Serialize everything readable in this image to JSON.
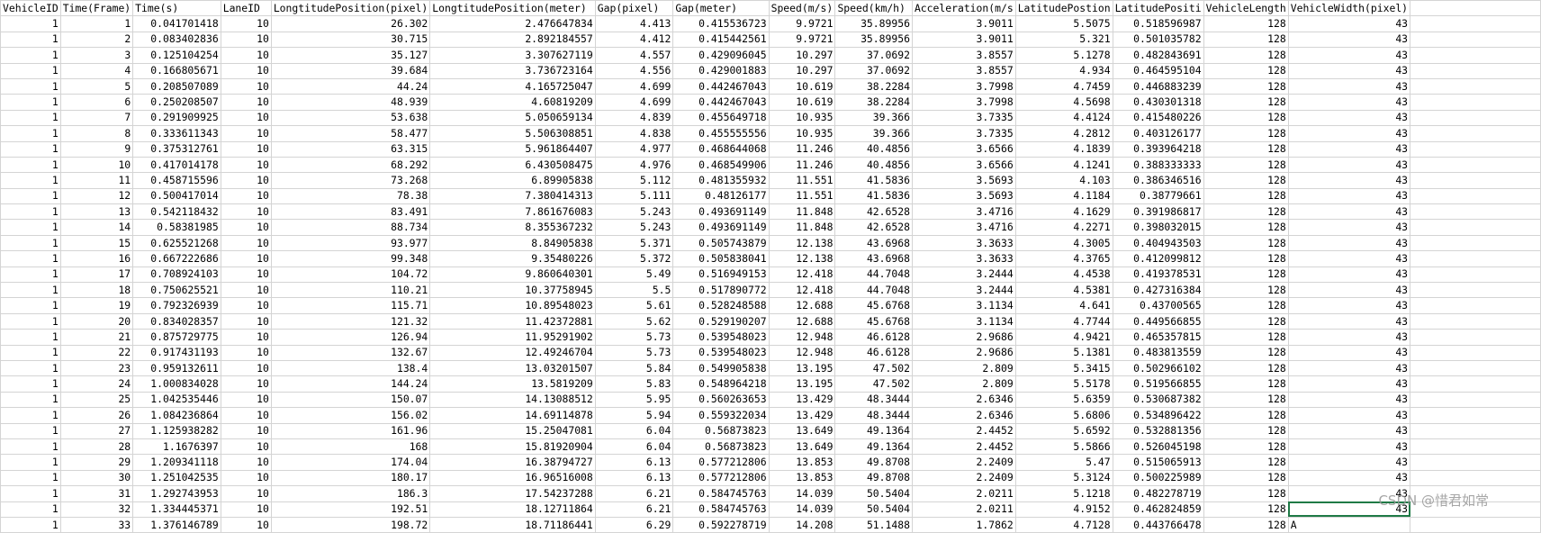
{
  "sheet": {
    "headers": [
      "VehicleID",
      "Time(Frame)",
      "Time(s)",
      "LaneID",
      "LongtitudePosition(pixel)",
      "LongtitudePosition(meter)",
      "Gap(pixel)",
      "Gap(meter)",
      "Speed(m/s)",
      "Speed(km/h)",
      "Acceleration(m/s",
      "LatitudePostion",
      "LatitudePositi",
      "VehicleLength",
      "VehicleWidth(pixel)",
      ""
    ],
    "rows": [
      [
        "1",
        "1",
        "0.041701418",
        "10",
        "26.302",
        "2.476647834",
        "4.413",
        "0.415536723",
        "9.9721",
        "35.89956",
        "3.9011",
        "5.5075",
        "0.518596987",
        "128",
        "43",
        ""
      ],
      [
        "1",
        "2",
        "0.083402836",
        "10",
        "30.715",
        "2.892184557",
        "4.412",
        "0.415442561",
        "9.9721",
        "35.89956",
        "3.9011",
        "5.321",
        "0.501035782",
        "128",
        "43",
        ""
      ],
      [
        "1",
        "3",
        "0.125104254",
        "10",
        "35.127",
        "3.307627119",
        "4.557",
        "0.429096045",
        "10.297",
        "37.0692",
        "3.8557",
        "5.1278",
        "0.482843691",
        "128",
        "43",
        ""
      ],
      [
        "1",
        "4",
        "0.166805671",
        "10",
        "39.684",
        "3.736723164",
        "4.556",
        "0.429001883",
        "10.297",
        "37.0692",
        "3.8557",
        "4.934",
        "0.464595104",
        "128",
        "43",
        ""
      ],
      [
        "1",
        "5",
        "0.208507089",
        "10",
        "44.24",
        "4.165725047",
        "4.699",
        "0.442467043",
        "10.619",
        "38.2284",
        "3.7998",
        "4.7459",
        "0.446883239",
        "128",
        "43",
        ""
      ],
      [
        "1",
        "6",
        "0.250208507",
        "10",
        "48.939",
        "4.60819209",
        "4.699",
        "0.442467043",
        "10.619",
        "38.2284",
        "3.7998",
        "4.5698",
        "0.430301318",
        "128",
        "43",
        ""
      ],
      [
        "1",
        "7",
        "0.291909925",
        "10",
        "53.638",
        "5.050659134",
        "4.839",
        "0.455649718",
        "10.935",
        "39.366",
        "3.7335",
        "4.4124",
        "0.415480226",
        "128",
        "43",
        ""
      ],
      [
        "1",
        "8",
        "0.333611343",
        "10",
        "58.477",
        "5.506308851",
        "4.838",
        "0.455555556",
        "10.935",
        "39.366",
        "3.7335",
        "4.2812",
        "0.403126177",
        "128",
        "43",
        ""
      ],
      [
        "1",
        "9",
        "0.375312761",
        "10",
        "63.315",
        "5.961864407",
        "4.977",
        "0.468644068",
        "11.246",
        "40.4856",
        "3.6566",
        "4.1839",
        "0.393964218",
        "128",
        "43",
        ""
      ],
      [
        "1",
        "10",
        "0.417014178",
        "10",
        "68.292",
        "6.430508475",
        "4.976",
        "0.468549906",
        "11.246",
        "40.4856",
        "3.6566",
        "4.1241",
        "0.388333333",
        "128",
        "43",
        ""
      ],
      [
        "1",
        "11",
        "0.458715596",
        "10",
        "73.268",
        "6.89905838",
        "5.112",
        "0.481355932",
        "11.551",
        "41.5836",
        "3.5693",
        "4.103",
        "0.386346516",
        "128",
        "43",
        ""
      ],
      [
        "1",
        "12",
        "0.500417014",
        "10",
        "78.38",
        "7.380414313",
        "5.111",
        "0.48126177",
        "11.551",
        "41.5836",
        "3.5693",
        "4.1184",
        "0.38779661",
        "128",
        "43",
        ""
      ],
      [
        "1",
        "13",
        "0.542118432",
        "10",
        "83.491",
        "7.861676083",
        "5.243",
        "0.493691149",
        "11.848",
        "42.6528",
        "3.4716",
        "4.1629",
        "0.391986817",
        "128",
        "43",
        ""
      ],
      [
        "1",
        "14",
        "0.58381985",
        "10",
        "88.734",
        "8.355367232",
        "5.243",
        "0.493691149",
        "11.848",
        "42.6528",
        "3.4716",
        "4.2271",
        "0.398032015",
        "128",
        "43",
        ""
      ],
      [
        "1",
        "15",
        "0.625521268",
        "10",
        "93.977",
        "8.84905838",
        "5.371",
        "0.505743879",
        "12.138",
        "43.6968",
        "3.3633",
        "4.3005",
        "0.404943503",
        "128",
        "43",
        ""
      ],
      [
        "1",
        "16",
        "0.667222686",
        "10",
        "99.348",
        "9.35480226",
        "5.372",
        "0.505838041",
        "12.138",
        "43.6968",
        "3.3633",
        "4.3765",
        "0.412099812",
        "128",
        "43",
        ""
      ],
      [
        "1",
        "17",
        "0.708924103",
        "10",
        "104.72",
        "9.860640301",
        "5.49",
        "0.516949153",
        "12.418",
        "44.7048",
        "3.2444",
        "4.4538",
        "0.419378531",
        "128",
        "43",
        ""
      ],
      [
        "1",
        "18",
        "0.750625521",
        "10",
        "110.21",
        "10.37758945",
        "5.5",
        "0.517890772",
        "12.418",
        "44.7048",
        "3.2444",
        "4.5381",
        "0.427316384",
        "128",
        "43",
        ""
      ],
      [
        "1",
        "19",
        "0.792326939",
        "10",
        "115.71",
        "10.89548023",
        "5.61",
        "0.528248588",
        "12.688",
        "45.6768",
        "3.1134",
        "4.641",
        "0.43700565",
        "128",
        "43",
        ""
      ],
      [
        "1",
        "20",
        "0.834028357",
        "10",
        "121.32",
        "11.42372881",
        "5.62",
        "0.529190207",
        "12.688",
        "45.6768",
        "3.1134",
        "4.7744",
        "0.449566855",
        "128",
        "43",
        ""
      ],
      [
        "1",
        "21",
        "0.875729775",
        "10",
        "126.94",
        "11.95291902",
        "5.73",
        "0.539548023",
        "12.948",
        "46.6128",
        "2.9686",
        "4.9421",
        "0.465357815",
        "128",
        "43",
        ""
      ],
      [
        "1",
        "22",
        "0.917431193",
        "10",
        "132.67",
        "12.49246704",
        "5.73",
        "0.539548023",
        "12.948",
        "46.6128",
        "2.9686",
        "5.1381",
        "0.483813559",
        "128",
        "43",
        ""
      ],
      [
        "1",
        "23",
        "0.959132611",
        "10",
        "138.4",
        "13.03201507",
        "5.84",
        "0.549905838",
        "13.195",
        "47.502",
        "2.809",
        "5.3415",
        "0.502966102",
        "128",
        "43",
        ""
      ],
      [
        "1",
        "24",
        "1.000834028",
        "10",
        "144.24",
        "13.5819209",
        "5.83",
        "0.548964218",
        "13.195",
        "47.502",
        "2.809",
        "5.5178",
        "0.519566855",
        "128",
        "43",
        ""
      ],
      [
        "1",
        "25",
        "1.042535446",
        "10",
        "150.07",
        "14.13088512",
        "5.95",
        "0.560263653",
        "13.429",
        "48.3444",
        "2.6346",
        "5.6359",
        "0.530687382",
        "128",
        "43",
        ""
      ],
      [
        "1",
        "26",
        "1.084236864",
        "10",
        "156.02",
        "14.69114878",
        "5.94",
        "0.559322034",
        "13.429",
        "48.3444",
        "2.6346",
        "5.6806",
        "0.534896422",
        "128",
        "43",
        ""
      ],
      [
        "1",
        "27",
        "1.125938282",
        "10",
        "161.96",
        "15.25047081",
        "6.04",
        "0.56873823",
        "13.649",
        "49.1364",
        "2.4452",
        "5.6592",
        "0.532881356",
        "128",
        "43",
        ""
      ],
      [
        "1",
        "28",
        "1.1676397",
        "10",
        "168",
        "15.81920904",
        "6.04",
        "0.56873823",
        "13.649",
        "49.1364",
        "2.4452",
        "5.5866",
        "0.526045198",
        "128",
        "43",
        ""
      ],
      [
        "1",
        "29",
        "1.209341118",
        "10",
        "174.04",
        "16.38794727",
        "6.13",
        "0.577212806",
        "13.853",
        "49.8708",
        "2.2409",
        "5.47",
        "0.515065913",
        "128",
        "43",
        ""
      ],
      [
        "1",
        "30",
        "1.251042535",
        "10",
        "180.17",
        "16.96516008",
        "6.13",
        "0.577212806",
        "13.853",
        "49.8708",
        "2.2409",
        "5.3124",
        "0.500225989",
        "128",
        "43",
        ""
      ],
      [
        "1",
        "31",
        "1.292743953",
        "10",
        "186.3",
        "17.54237288",
        "6.21",
        "0.584745763",
        "14.039",
        "50.5404",
        "2.0211",
        "5.1218",
        "0.482278719",
        "128",
        "43",
        ""
      ],
      [
        "1",
        "32",
        "1.334445371",
        "10",
        "192.51",
        "18.12711864",
        "6.21",
        "0.584745763",
        "14.039",
        "50.5404",
        "2.0211",
        "4.9152",
        "0.462824859",
        "128",
        "43",
        ""
      ],
      [
        "1",
        "33",
        "1.376146789",
        "10",
        "198.72",
        "18.71186441",
        "6.29",
        "0.592278719",
        "14.208",
        "51.1488",
        "1.7862",
        "4.7128",
        "0.443766478",
        "128",
        "A",
        ""
      ]
    ]
  },
  "watermark": "CSDN @惜君如常"
}
